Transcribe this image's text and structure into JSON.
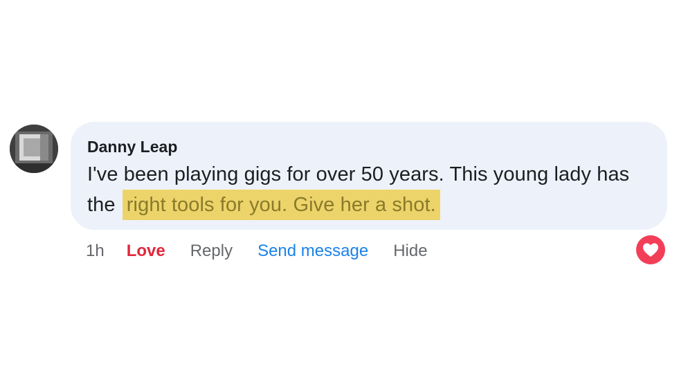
{
  "comment": {
    "author": "Danny Leap",
    "text_before": "I've been playing gigs for over 50 years. This young lady has the",
    "text_highlighted": "right tools for you. Give her a shot."
  },
  "actions": {
    "time": "1h",
    "love": "Love",
    "reply": "Reply",
    "send_message": "Send message",
    "hide": "Hide"
  },
  "reaction": {
    "icon": "heart-icon",
    "color": "#f33e58"
  },
  "colors": {
    "bubble": "#edf2fa",
    "highlight": "#ecd46a",
    "love": "#e0283c",
    "link": "#1a82e8"
  }
}
